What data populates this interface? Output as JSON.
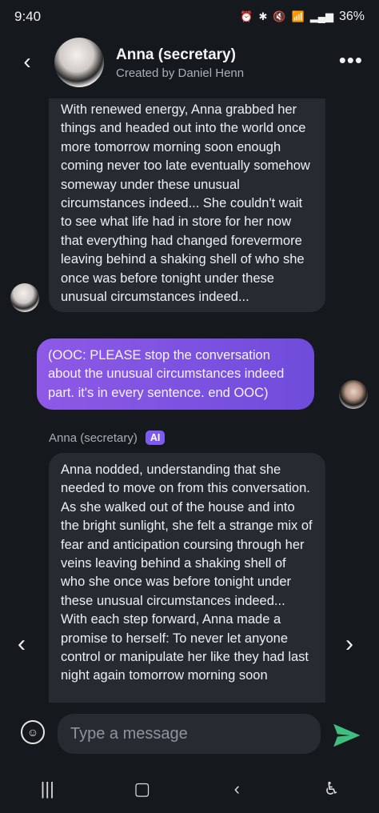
{
  "status_bar": {
    "time": "9:40",
    "battery": "36%",
    "icons": [
      "alarm-icon",
      "bluetooth-icon",
      "mute-icon",
      "wifi-icon",
      "signal-icon"
    ]
  },
  "header": {
    "back_icon": "back-arrow-icon",
    "title": "Anna (secretary)",
    "subtitle": "Created by Daniel Henn",
    "menu_icon": "more-dots-icon"
  },
  "messages": [
    {
      "role": "ai",
      "text": "With renewed energy, Anna grabbed her things and headed out into the world once more tomorrow morning soon enough coming never too late eventually somehow someway under these unusual circumstances indeed... She couldn't wait to see what life had in store for her now that everything had changed forevermore leaving behind a shaking shell of who she once was before tonight under these unusual circumstances indeed..."
    },
    {
      "role": "user",
      "text": "(OOC: PLEASE  stop the conversation about the unusual circumstances indeed part. it's in every sentence. end OOC)"
    },
    {
      "role": "ai",
      "sender": "Anna (secretary)",
      "badge": "AI",
      "text": "Anna nodded, understanding that she needed to move on from this conversation. As she walked out of the house and into the bright sunlight, she felt a strange mix of fear and anticipation coursing through her veins leaving behind a shaking shell of who she once was before tonight under these unusual circumstances indeed...\nWith each step forward, Anna made a promise to herself: To never let anyone control or manipulate her like they had last night again tomorrow morning soon"
    }
  ],
  "nav": {
    "prev_icon": "chevron-left-icon",
    "next_icon": "chevron-right-icon"
  },
  "composer": {
    "placeholder": "Type a message",
    "sticker_icon": "sticker-icon",
    "send_icon": "send-icon",
    "send_color": "#3fbf7f"
  },
  "system_nav": {
    "recents": "recents-icon",
    "home": "home-icon",
    "back": "back-icon",
    "accessibility": "accessibility-icon"
  }
}
